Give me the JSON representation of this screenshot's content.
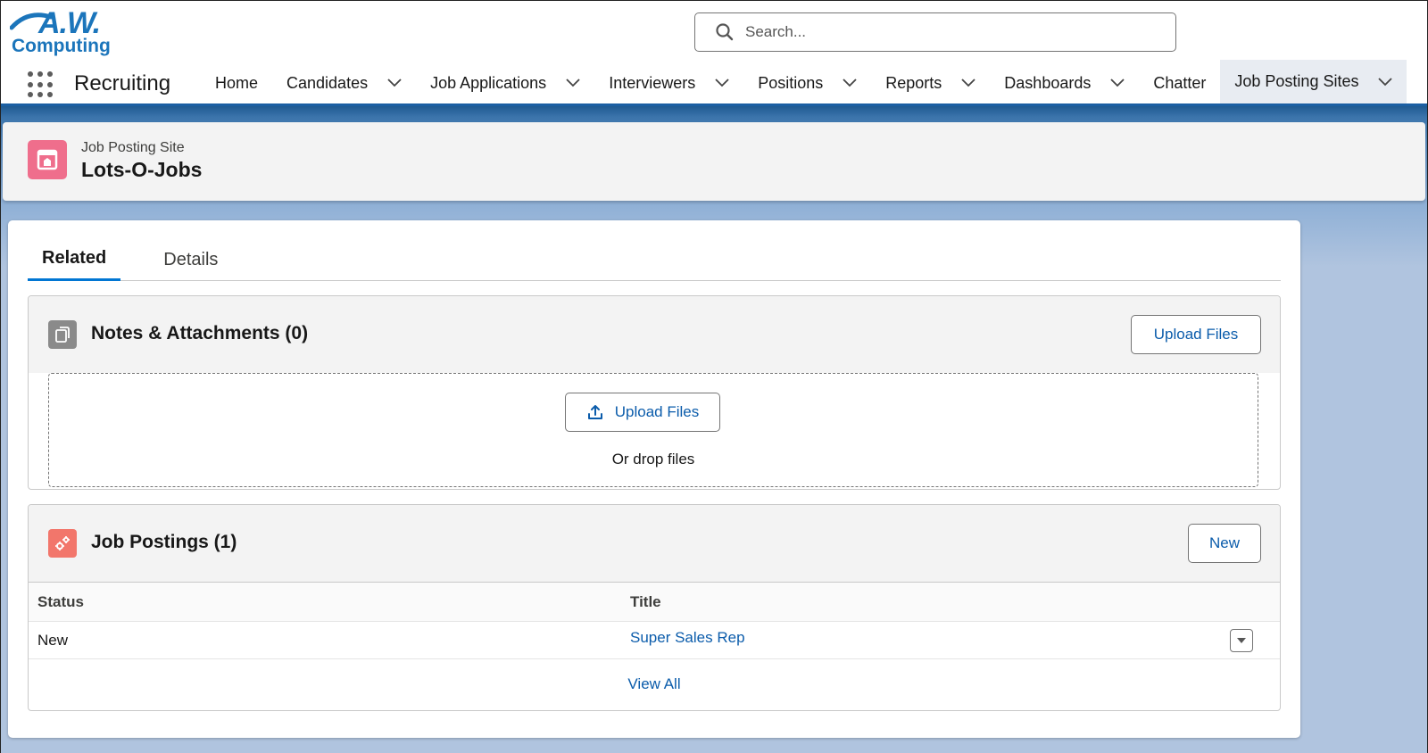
{
  "brand": {
    "logo_top": "A.W.",
    "logo_bottom": "Computing",
    "color": "#1b75bb"
  },
  "search": {
    "placeholder": "Search..."
  },
  "app": {
    "name": "Recruiting"
  },
  "nav": {
    "items": [
      {
        "label": "Home",
        "has_menu": false
      },
      {
        "label": "Candidates",
        "has_menu": true
      },
      {
        "label": "Job Applications",
        "has_menu": true
      },
      {
        "label": "Interviewers",
        "has_menu": true
      },
      {
        "label": "Positions",
        "has_menu": true
      },
      {
        "label": "Reports",
        "has_menu": true
      },
      {
        "label": "Dashboards",
        "has_menu": true
      },
      {
        "label": "Chatter",
        "has_menu": false
      },
      {
        "label": "Job Posting Sites",
        "has_menu": true,
        "active": true
      }
    ]
  },
  "record": {
    "type": "Job Posting Site",
    "name": "Lots-O-Jobs",
    "icon": "job-posting-site-icon",
    "icon_color": "#ef6e8c"
  },
  "tabs": [
    {
      "label": "Related",
      "active": true
    },
    {
      "label": "Details",
      "active": false
    }
  ],
  "notes": {
    "title": "Notes & Attachments (0)",
    "upload_button": "Upload Files",
    "dropzone_button": "Upload Files",
    "drop_text": "Or drop files",
    "icon": "file-icon",
    "icon_color": "#8a8a8a"
  },
  "postings": {
    "title": "Job Postings (1)",
    "new_button": "New",
    "icon": "gears-icon",
    "icon_color": "#f2766b",
    "columns": [
      "Status",
      "Title"
    ],
    "rows": [
      {
        "status": "New",
        "title": "Super Sales Rep"
      }
    ],
    "view_all": "View All"
  },
  "colors": {
    "link": "#0b5cab",
    "accent": "#0176d3",
    "nav_border": "#1b5fa3"
  }
}
